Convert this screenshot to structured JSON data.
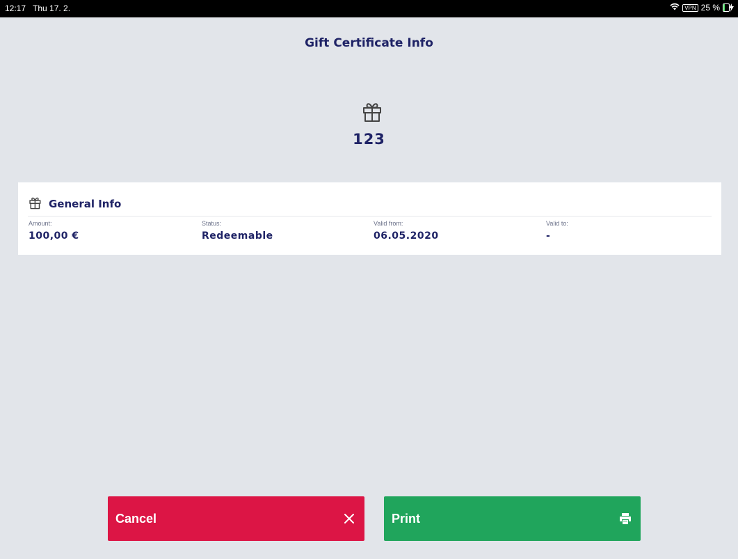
{
  "status_bar": {
    "time": "12:17",
    "date": "Thu 17. 2.",
    "vpn": "VPN",
    "battery": "25 %",
    "battery_level": 0.25,
    "battery_color": "#4cd964"
  },
  "page": {
    "title": "Gift Certificate Info",
    "icon": "gift-icon",
    "number": "123"
  },
  "general_info": {
    "icon": "gift-icon",
    "title": "General Info",
    "fields": [
      {
        "label": "Amount:",
        "value": "100,00 €"
      },
      {
        "label": "Status:",
        "value": "Redeemable"
      },
      {
        "label": "Valid from:",
        "value": "06.05.2020"
      },
      {
        "label": "Valid to:",
        "value": "-"
      }
    ]
  },
  "actions": {
    "cancel": {
      "label": "Cancel",
      "icon": "close-icon",
      "color": "#dc1545"
    },
    "print": {
      "label": "Print",
      "icon": "printer-icon",
      "color": "#20a55c"
    }
  },
  "colors": {
    "background": "#e2e5ea",
    "text_primary": "#1f2366"
  }
}
